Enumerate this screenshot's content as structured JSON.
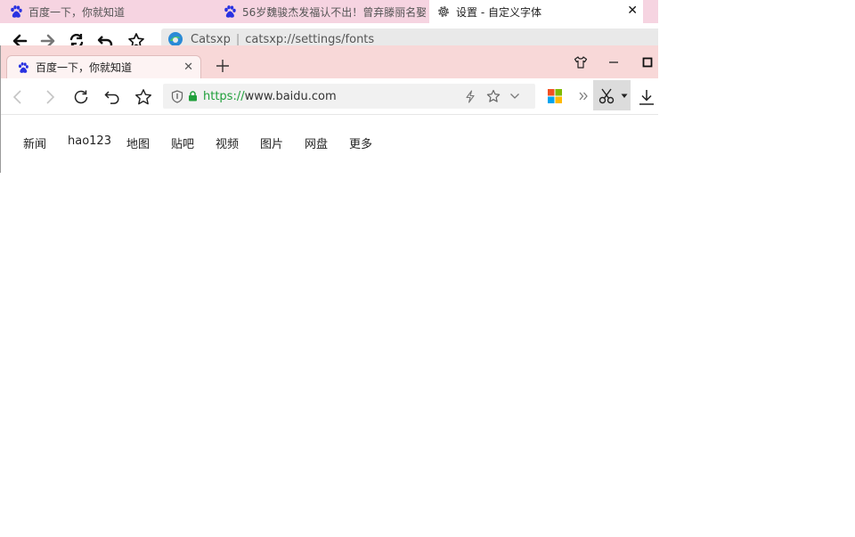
{
  "outer": {
    "tabs": [
      {
        "title": "百度一下，你就知道",
        "icon": "baidu-paw-icon"
      },
      {
        "title": "56岁魏骏杰发福认不出！曾弃滕丽名娶",
        "icon": "baidu-paw-icon"
      },
      {
        "title": "设置 - 自定义字体",
        "icon": "gear-icon",
        "active": true
      }
    ],
    "address": {
      "site": "Catsxp",
      "url": "catsxp://settings/fonts"
    }
  },
  "inner": {
    "tab": {
      "title": "百度一下，你就知道",
      "icon": "baidu-paw-icon"
    },
    "address": {
      "scheme": "https://",
      "rest": "www.baidu.com"
    },
    "nav_links": [
      "新闻",
      "hao123",
      "地图",
      "贴吧",
      "视频",
      "图片",
      "网盘",
      "更多"
    ]
  },
  "colors": {
    "outer_tabbar": "#f6d4e1",
    "inner_tabbar": "#f8d8d8",
    "secure_green": "#1f9f3a",
    "baidu_blue": "#2932e1"
  }
}
